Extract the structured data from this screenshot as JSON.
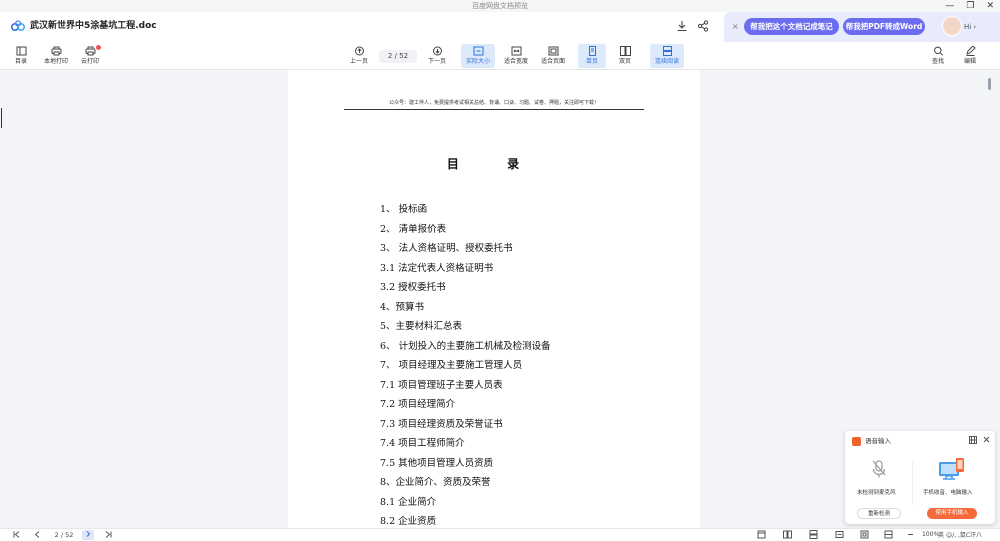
{
  "window": {
    "title": "百度网盘文档预览",
    "controls": [
      "—",
      "❐",
      "✕"
    ]
  },
  "header": {
    "doc_title": "武汉新世界中5涂基坑工程.doc",
    "ai": {
      "close": "×",
      "pill_notes": "帮我把这个文档记成笔记",
      "pill_word": "帮我把PDF转成Word",
      "greeting": "Hi ›"
    }
  },
  "toolbar": {
    "toc": "目录",
    "local_print": "本地打印",
    "cloud_print": "云打印",
    "prev": "上一页",
    "page_indicator": "2 / 52",
    "next": "下一页",
    "actual_size": "实际大小",
    "fit_width": "适合宽度",
    "fit_page": "适合页面",
    "single": "单页",
    "double": "双页",
    "continuous": "连续阅读",
    "search": "查找",
    "edit": "编辑"
  },
  "document": {
    "header_text": "公众号：建工伴人，免费提供考试相关总结、背诵、口诀、习题、试卷、押题，关注即可下载！",
    "toc_title": "目  录",
    "toc_items": [
      "1、 投标函",
      "2、 清单报价表",
      "3、 法人资格证明、授权委托书",
      "3.1  法定代表人资格证明书",
      "3.2  授权委托书",
      "4、预算书",
      "5、主要材料汇总表",
      "6、 计划投入的主要施工机械及检测设备",
      "7、 项目经理及主要施工管理人员",
      "7.1  项目管理班子主要人员表",
      "7.2  项目经理简介",
      "7.3  项目经理资质及荣誉证书",
      "7.4  项目工程师简介",
      "7.5  其他项目管理人员资质",
      "8、企业简介、资质及荣誉",
      "8.1 企业简介",
      "8.2 企业资质"
    ]
  },
  "voice_popup": {
    "title": "语音输入",
    "no_mic": "未检测到麦克风",
    "phone_input": "手机收音、电脑输入",
    "recheck": "重新检测",
    "use_phone": "使用手机输入"
  },
  "bottom": {
    "page_indicator": "2 / 52",
    "zoom": "100%",
    "ime": "英",
    "ime_status": "☺/, ,鼠C汗八"
  },
  "colors": {
    "accent": "#2f6fd8",
    "ai_pill": "#6c6cf0",
    "orange": "#f56a3a"
  }
}
